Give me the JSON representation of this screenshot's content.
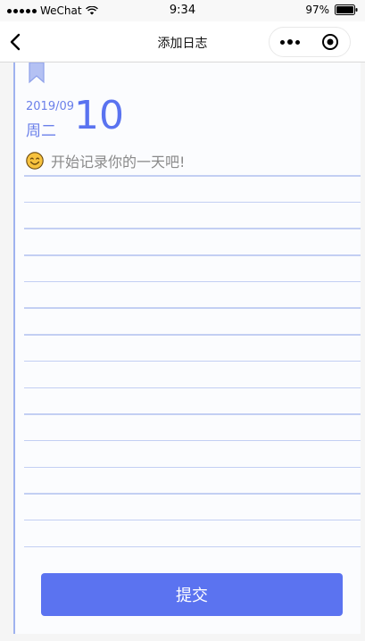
{
  "status_bar": {
    "carrier": "WeChat",
    "time": "9:34",
    "battery": "97%"
  },
  "nav": {
    "title": "添加日志"
  },
  "entry": {
    "year_month": "2019/09",
    "weekday": "周二",
    "day": "10",
    "prompt": "开始记录你的一天吧!"
  },
  "lines_count": 15,
  "submit": {
    "label": "提交"
  },
  "colors": {
    "accent": "#5b73f0",
    "date_text": "#6b80ea",
    "rule_line": "#c3cff3",
    "margin_line": "#9fb2ef"
  }
}
